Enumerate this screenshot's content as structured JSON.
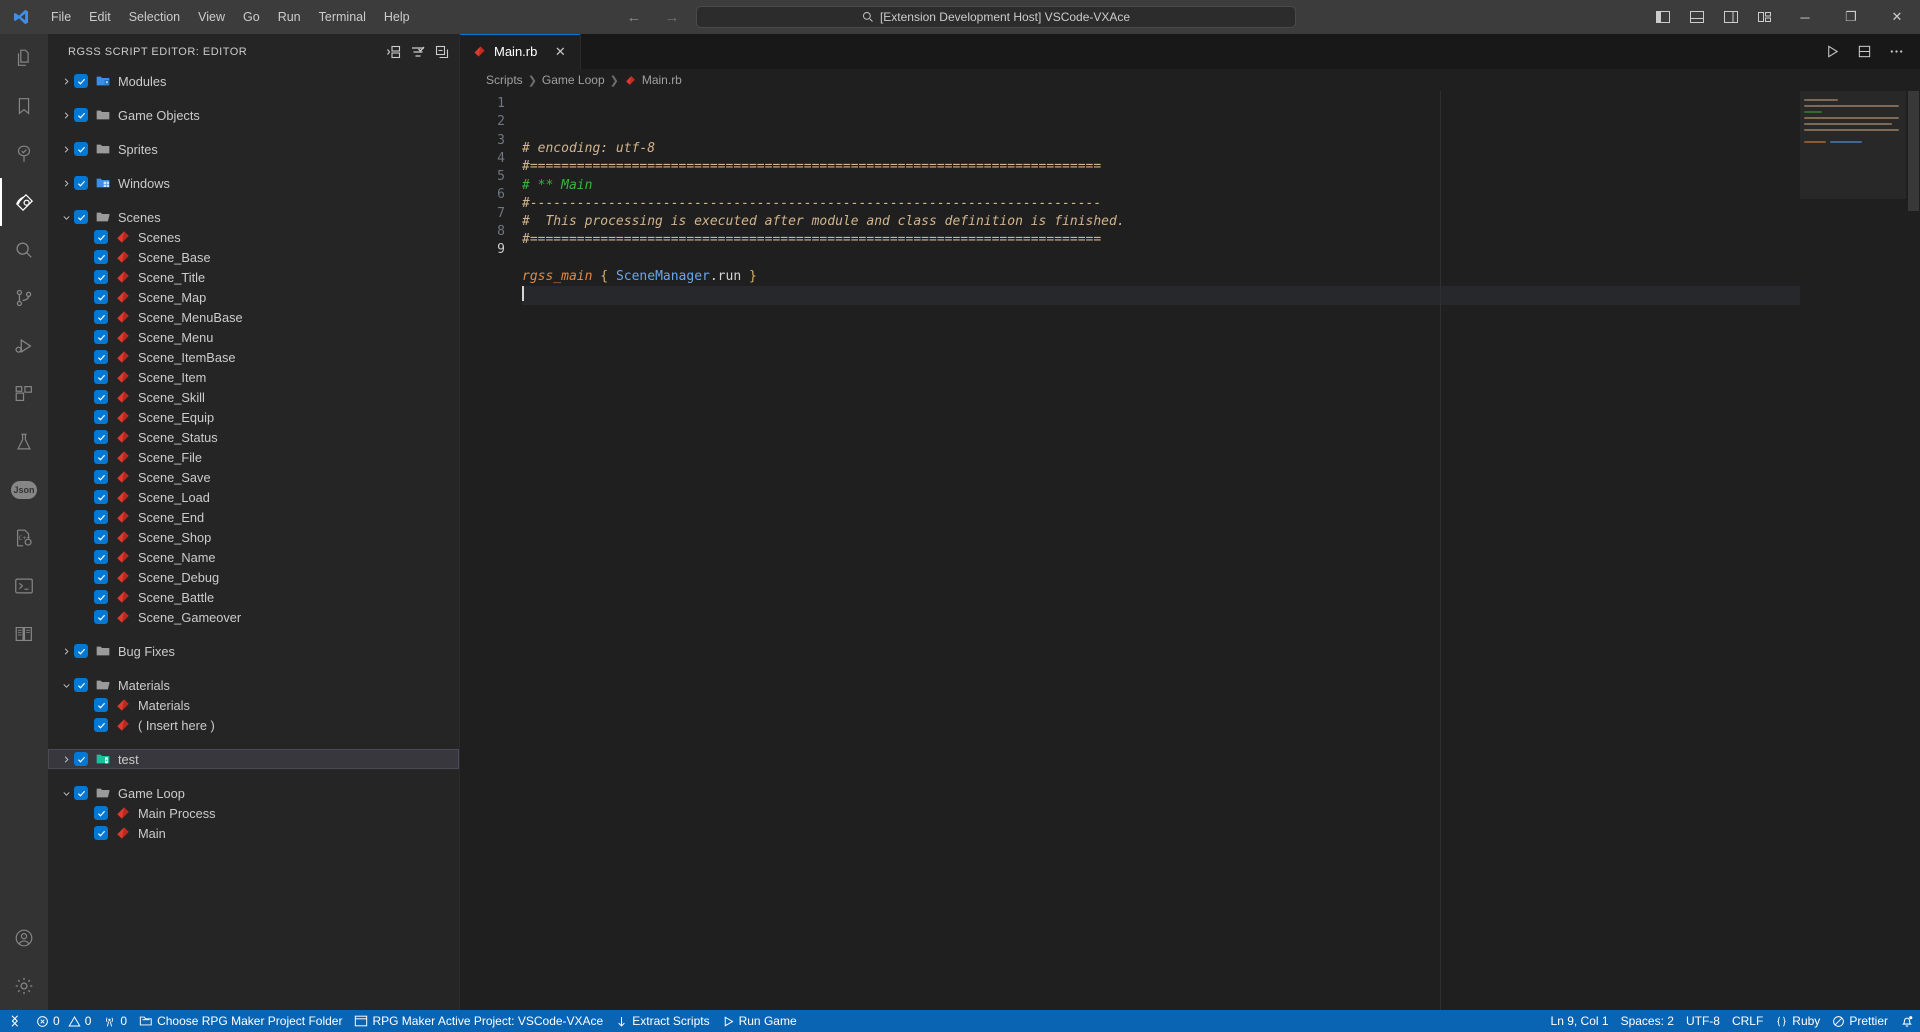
{
  "titlebar": {
    "logo_icon": "vscode-logo-icon",
    "menus": [
      "File",
      "Edit",
      "Selection",
      "View",
      "Go",
      "Run",
      "Terminal",
      "Help"
    ],
    "back_icon": "arrow-left-icon",
    "forward_icon": "arrow-right-icon",
    "quickinput_text": "[Extension Development Host] VSCode-VXAce",
    "quickinput_icon": "search-icon",
    "layout_buttons": [
      "toggle-primary-sidebar-icon",
      "toggle-panel-icon",
      "toggle-secondary-sidebar-icon",
      "customize-layout-icon"
    ],
    "window_minimize": "─",
    "window_maximize": "❐",
    "window_close": "✕"
  },
  "activitybar": {
    "items": [
      {
        "name": "explorer",
        "icon": "files-icon",
        "active": false
      },
      {
        "name": "bookmarks",
        "icon": "bookmark-icon",
        "active": false
      },
      {
        "name": "source-tree",
        "icon": "tree-check-icon",
        "active": false
      },
      {
        "name": "rgss-script-editor",
        "icon": "ruby-gem-icon",
        "active": true
      },
      {
        "name": "search",
        "icon": "search-icon",
        "active": false
      },
      {
        "name": "source-control",
        "icon": "source-control-icon",
        "active": false
      },
      {
        "name": "run-and-debug",
        "icon": "run-debug-icon",
        "active": false
      },
      {
        "name": "extensions",
        "icon": "extensions-icon",
        "active": false
      },
      {
        "name": "testing",
        "icon": "beaker-icon",
        "active": false
      },
      {
        "name": "json-tools",
        "icon": "json-icon",
        "active": false,
        "badge": "Json"
      },
      {
        "name": "cpp-config",
        "icon": "cpp-gear-icon",
        "active": false
      },
      {
        "name": "terminal-panel",
        "icon": "terminal-icon",
        "active": false
      },
      {
        "name": "docs",
        "icon": "book-icon",
        "active": false
      }
    ],
    "bottom_items": [
      {
        "name": "accounts",
        "icon": "account-icon"
      },
      {
        "name": "manage-settings",
        "icon": "gear-icon"
      }
    ]
  },
  "sidebar": {
    "title": "RGSS SCRIPT EDITOR: EDITOR",
    "actions": [
      {
        "name": "collapse-section",
        "icon": "collapse-right-icon"
      },
      {
        "name": "filter",
        "icon": "filter-check-icon"
      },
      {
        "name": "collapse-all",
        "icon": "collapse-all-icon"
      }
    ],
    "tree": [
      {
        "label": "Modules",
        "icon": "folder-modules-icon",
        "indent": 0,
        "twisty": "collapsed",
        "checked": true,
        "gap_after": true
      },
      {
        "label": "Game Objects",
        "icon": "folder-icon",
        "indent": 0,
        "twisty": "collapsed",
        "checked": true,
        "gap_after": true
      },
      {
        "label": "Sprites",
        "icon": "folder-icon",
        "indent": 0,
        "twisty": "collapsed",
        "checked": true,
        "gap_after": true
      },
      {
        "label": "Windows",
        "icon": "folder-windows-icon",
        "indent": 0,
        "twisty": "collapsed",
        "checked": true,
        "gap_after": true
      },
      {
        "label": "Scenes",
        "icon": "folder-open-icon",
        "indent": 0,
        "twisty": "expanded",
        "checked": true
      },
      {
        "label": "Scenes",
        "icon": "ruby-icon",
        "indent": 1,
        "twisty": "none",
        "checked": true
      },
      {
        "label": "Scene_Base",
        "icon": "ruby-icon",
        "indent": 1,
        "twisty": "none",
        "checked": true
      },
      {
        "label": "Scene_Title",
        "icon": "ruby-icon",
        "indent": 1,
        "twisty": "none",
        "checked": true
      },
      {
        "label": "Scene_Map",
        "icon": "ruby-icon",
        "indent": 1,
        "twisty": "none",
        "checked": true
      },
      {
        "label": "Scene_MenuBase",
        "icon": "ruby-icon",
        "indent": 1,
        "twisty": "none",
        "checked": true
      },
      {
        "label": "Scene_Menu",
        "icon": "ruby-icon",
        "indent": 1,
        "twisty": "none",
        "checked": true
      },
      {
        "label": "Scene_ItemBase",
        "icon": "ruby-icon",
        "indent": 1,
        "twisty": "none",
        "checked": true
      },
      {
        "label": "Scene_Item",
        "icon": "ruby-icon",
        "indent": 1,
        "twisty": "none",
        "checked": true
      },
      {
        "label": "Scene_Skill",
        "icon": "ruby-icon",
        "indent": 1,
        "twisty": "none",
        "checked": true
      },
      {
        "label": "Scene_Equip",
        "icon": "ruby-icon",
        "indent": 1,
        "twisty": "none",
        "checked": true
      },
      {
        "label": "Scene_Status",
        "icon": "ruby-icon",
        "indent": 1,
        "twisty": "none",
        "checked": true
      },
      {
        "label": "Scene_File",
        "icon": "ruby-icon",
        "indent": 1,
        "twisty": "none",
        "checked": true
      },
      {
        "label": "Scene_Save",
        "icon": "ruby-icon",
        "indent": 1,
        "twisty": "none",
        "checked": true
      },
      {
        "label": "Scene_Load",
        "icon": "ruby-icon",
        "indent": 1,
        "twisty": "none",
        "checked": true
      },
      {
        "label": "Scene_End",
        "icon": "ruby-icon",
        "indent": 1,
        "twisty": "none",
        "checked": true
      },
      {
        "label": "Scene_Shop",
        "icon": "ruby-icon",
        "indent": 1,
        "twisty": "none",
        "checked": true
      },
      {
        "label": "Scene_Name",
        "icon": "ruby-icon",
        "indent": 1,
        "twisty": "none",
        "checked": true
      },
      {
        "label": "Scene_Debug",
        "icon": "ruby-icon",
        "indent": 1,
        "twisty": "none",
        "checked": true
      },
      {
        "label": "Scene_Battle",
        "icon": "ruby-icon",
        "indent": 1,
        "twisty": "none",
        "checked": true
      },
      {
        "label": "Scene_Gameover",
        "icon": "ruby-icon",
        "indent": 1,
        "twisty": "none",
        "checked": true,
        "gap_after": true
      },
      {
        "label": "Bug Fixes",
        "icon": "folder-icon",
        "indent": 0,
        "twisty": "collapsed",
        "checked": true,
        "gap_after": true
      },
      {
        "label": "Materials",
        "icon": "folder-open-icon",
        "indent": 0,
        "twisty": "expanded",
        "checked": true
      },
      {
        "label": "Materials",
        "icon": "ruby-icon",
        "indent": 1,
        "twisty": "none",
        "checked": true
      },
      {
        "label": "( Insert here )",
        "icon": "ruby-icon",
        "indent": 1,
        "twisty": "none",
        "checked": true,
        "gap_after": true
      },
      {
        "label": "test",
        "icon": "folder-test-icon",
        "indent": 0,
        "twisty": "collapsed",
        "checked": true,
        "selected": true,
        "gap_after": true
      },
      {
        "label": "Game Loop",
        "icon": "folder-open-icon",
        "indent": 0,
        "twisty": "expanded",
        "checked": true
      },
      {
        "label": "Main Process",
        "icon": "ruby-icon",
        "indent": 1,
        "twisty": "none",
        "checked": true
      },
      {
        "label": "Main",
        "icon": "ruby-icon",
        "indent": 1,
        "twisty": "none",
        "checked": true
      }
    ]
  },
  "editor": {
    "tab": {
      "label": "Main.rb",
      "icon": "ruby-icon",
      "close_icon": "close-icon",
      "active": true
    },
    "actions": [
      {
        "name": "run-file",
        "icon": "play-icon"
      },
      {
        "name": "split-editor-down",
        "icon": "split-editor-icon"
      },
      {
        "name": "more-actions",
        "icon": "ellipsis-icon"
      }
    ],
    "breadcrumb": [
      "Scripts",
      "Game Loop",
      "Main.rb"
    ],
    "breadcrumb_file_icon": "ruby-icon",
    "lines": [
      {
        "n": 1,
        "tokens": [
          {
            "t": "cmt",
            "v": "# encoding: utf-8"
          }
        ]
      },
      {
        "n": 2,
        "tokens": [
          {
            "t": "cmt",
            "v": "#========================================================================="
          }
        ]
      },
      {
        "n": 3,
        "tokens": [
          {
            "t": "cmt-green",
            "v": "# ** Main"
          }
        ]
      },
      {
        "n": 4,
        "tokens": [
          {
            "t": "cmt",
            "v": "#-------------------------------------------------------------------------"
          }
        ]
      },
      {
        "n": 5,
        "tokens": [
          {
            "t": "cmt",
            "v": "#  This processing is executed after module and class definition is finished."
          }
        ]
      },
      {
        "n": 6,
        "tokens": [
          {
            "t": "cmt",
            "v": "#========================================================================="
          }
        ]
      },
      {
        "n": 7,
        "tokens": []
      },
      {
        "n": 8,
        "tokens": [
          {
            "t": "kw",
            "v": "rgss_main"
          },
          {
            "t": "plain",
            "v": " "
          },
          {
            "t": "pun",
            "v": "{"
          },
          {
            "t": "plain",
            "v": " "
          },
          {
            "t": "cls",
            "v": "SceneManager"
          },
          {
            "t": "plain",
            "v": ".run "
          },
          {
            "t": "pun",
            "v": "}"
          }
        ]
      },
      {
        "n": 9,
        "tokens": [],
        "current": true,
        "caret": true
      }
    ]
  },
  "statusbar": {
    "remote_icon": "remote-indicator-icon",
    "left": [
      {
        "name": "problems",
        "icon": "error-warning-icon",
        "label": "0 ⚠ 0",
        "errors": "0",
        "warnings": "0"
      },
      {
        "name": "ports",
        "icon": "radio-tower-icon",
        "label": "0"
      },
      {
        "name": "choose-rpg-maker-project-folder",
        "icon": "folder-opened-icon",
        "label": "Choose RPG Maker Project Folder"
      },
      {
        "name": "rpg-maker-active-project",
        "icon": "window-icon",
        "label": "RPG Maker Active Project: VSCode-VXAce"
      },
      {
        "name": "extract-scripts",
        "icon": "arrow-down-icon",
        "label": "Extract Scripts"
      },
      {
        "name": "run-game",
        "icon": "play-icon",
        "label": "Run Game"
      }
    ],
    "right": [
      {
        "name": "editor-position",
        "label": "Ln 9, Col 1"
      },
      {
        "name": "indentation",
        "label": "Spaces: 2"
      },
      {
        "name": "encoding",
        "label": "UTF-8"
      },
      {
        "name": "eol",
        "label": "CRLF"
      },
      {
        "name": "language-mode",
        "icon": "braces-icon",
        "label": "Ruby"
      },
      {
        "name": "prettier",
        "icon": "circle-slash-icon",
        "label": "Prettier"
      },
      {
        "name": "notifications",
        "icon": "bell-dot-icon",
        "label": ""
      }
    ]
  },
  "colors": {
    "accent": "#0078d4",
    "statusbar": "#0a64b4",
    "titlebar": "#3c3c3c",
    "sidebar": "#252526",
    "editor": "#1f1f1f",
    "ruby_red": "#e03a2f",
    "comment": "#d3b48c",
    "comment_green": "#3db33d",
    "keyword_orange": "#e08a45",
    "class_blue": "#6aa6e8"
  }
}
